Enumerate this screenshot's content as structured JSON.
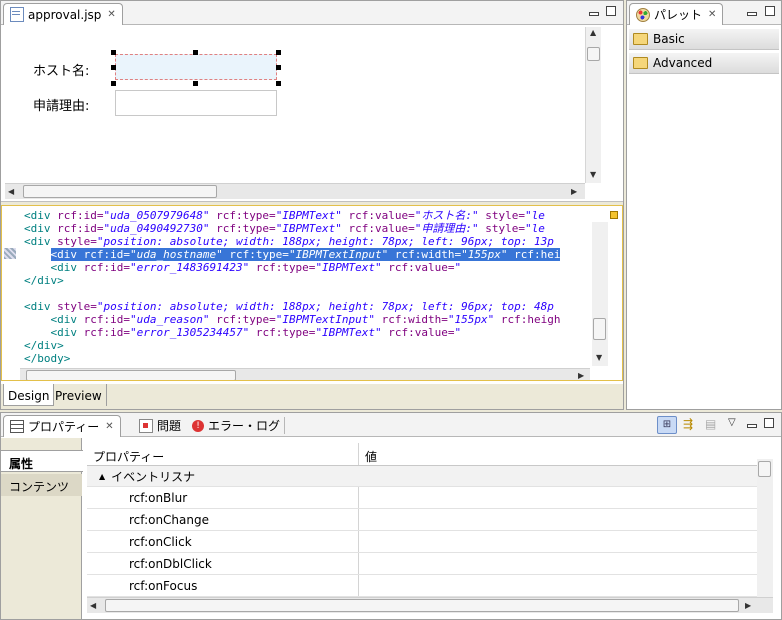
{
  "editor": {
    "tab_label": "approval.jsp",
    "form": {
      "host_label": "ホスト名:",
      "reason_label": "申請理由:"
    },
    "code_lines": [
      {
        "indent": "",
        "parts": [
          [
            "tag",
            "<div "
          ],
          [
            "attr",
            "rcf:id="
          ],
          [
            "val",
            "\"uda_0507979648\""
          ],
          [
            "attr",
            " rcf:type="
          ],
          [
            "val",
            "\"IBPMText\""
          ],
          [
            "attr",
            " rcf:value="
          ],
          [
            "val",
            "\"ホスト名:\""
          ],
          [
            "attr",
            " style="
          ],
          [
            "val",
            "\"le"
          ]
        ]
      },
      {
        "indent": "",
        "parts": [
          [
            "tag",
            "<div "
          ],
          [
            "attr",
            "rcf:id="
          ],
          [
            "val",
            "\"uda_0490492730\""
          ],
          [
            "attr",
            " rcf:type="
          ],
          [
            "val",
            "\"IBPMText\""
          ],
          [
            "attr",
            " rcf:value="
          ],
          [
            "val",
            "\"申請理由:\""
          ],
          [
            "attr",
            " style="
          ],
          [
            "val",
            "\"le"
          ]
        ]
      },
      {
        "indent": "",
        "parts": [
          [
            "tag",
            "<div "
          ],
          [
            "attr",
            "style="
          ],
          [
            "val",
            "\"position: absolute; width: 188px; height: 78px; left: 96px; top: 13p"
          ]
        ]
      },
      {
        "indent": "    ",
        "selected": true,
        "parts": [
          [
            "tag",
            "<div "
          ],
          [
            "attr",
            "rcf:id="
          ],
          [
            "val",
            "\"uda_hostname\""
          ],
          [
            "attr",
            " rcf:type="
          ],
          [
            "val",
            "\"IBPMTextInput\""
          ],
          [
            "attr",
            " rcf:width="
          ],
          [
            "val",
            "\"155px\""
          ],
          [
            "attr",
            " rcf:hei"
          ]
        ]
      },
      {
        "indent": "    ",
        "parts": [
          [
            "tag",
            "<div "
          ],
          [
            "attr",
            "rcf:id="
          ],
          [
            "val",
            "\"error_1483691423\""
          ],
          [
            "attr",
            " rcf:type="
          ],
          [
            "val",
            "\"IBPMText\""
          ],
          [
            "attr",
            " rcf:value="
          ],
          [
            "val",
            "\""
          ]
        ]
      },
      {
        "indent": "",
        "parts": [
          [
            "tag",
            "</div>"
          ]
        ]
      },
      {
        "indent": "",
        "parts": []
      },
      {
        "indent": "",
        "parts": [
          [
            "tag",
            "<div "
          ],
          [
            "attr",
            "style="
          ],
          [
            "val",
            "\"position: absolute; width: 188px; height: 78px; left: 96px; top: 48p"
          ]
        ]
      },
      {
        "indent": "    ",
        "parts": [
          [
            "tag",
            "<div "
          ],
          [
            "attr",
            "rcf:id="
          ],
          [
            "val",
            "\"uda_reason\""
          ],
          [
            "attr",
            " rcf:type="
          ],
          [
            "val",
            "\"IBPMTextInput\""
          ],
          [
            "attr",
            " rcf:width="
          ],
          [
            "val",
            "\"155px\""
          ],
          [
            "attr",
            " rcf:heigh"
          ]
        ]
      },
      {
        "indent": "    ",
        "parts": [
          [
            "tag",
            "<div "
          ],
          [
            "attr",
            "rcf:id="
          ],
          [
            "val",
            "\"error_1305234457\""
          ],
          [
            "attr",
            " rcf:type="
          ],
          [
            "val",
            "\"IBPMText\""
          ],
          [
            "attr",
            " rcf:value="
          ],
          [
            "val",
            "\""
          ]
        ]
      },
      {
        "indent": "",
        "parts": [
          [
            "tag",
            "</div>"
          ]
        ]
      },
      {
        "indent": "",
        "parts": [
          [
            "tag",
            "</body>"
          ]
        ]
      }
    ],
    "bottom_tabs": {
      "design": "Design",
      "preview": "Preview"
    }
  },
  "palette": {
    "tab_label": "パレット",
    "drawers": [
      {
        "label": "Basic"
      },
      {
        "label": "Advanced"
      }
    ]
  },
  "properties": {
    "tabs": [
      {
        "label": "プロパティー",
        "icon": "properties-icon"
      },
      {
        "label": "問題",
        "icon": "problems-icon"
      },
      {
        "label": "エラー・ログ",
        "icon": "error-log-icon"
      }
    ],
    "side_tabs": [
      "属性",
      "コンテンツ"
    ],
    "columns": {
      "property": "プロパティー",
      "value": "値"
    },
    "category": "イベントリスナ",
    "rows": [
      "rcf:onBlur",
      "rcf:onChange",
      "rcf:onClick",
      "rcf:onDblClick",
      "rcf:onFocus"
    ]
  }
}
